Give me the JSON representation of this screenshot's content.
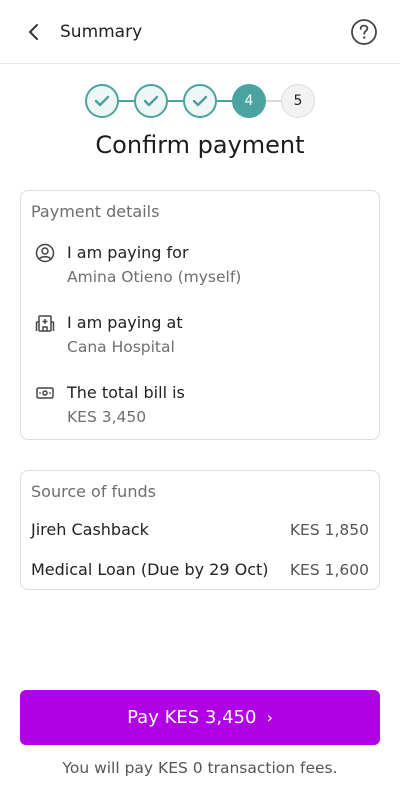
{
  "header": {
    "title": "Summary"
  },
  "stepper": {
    "steps": [
      "1",
      "2",
      "3",
      "4",
      "5"
    ],
    "current": 4
  },
  "page": {
    "title": "Confirm payment"
  },
  "payment_details": {
    "title": "Payment details",
    "items": [
      {
        "icon": "user-circle-icon",
        "label": "I am paying for",
        "value": "Amina Otieno (myself)"
      },
      {
        "icon": "hospital-icon",
        "label": "I am paying at",
        "value": "Cana Hospital"
      },
      {
        "icon": "cash-icon",
        "label": "The total bill is",
        "value": "KES 3,450"
      }
    ]
  },
  "funds": {
    "title": "Source of funds",
    "items": [
      {
        "name": "Jireh Cashback",
        "amount": "KES 1,850"
      },
      {
        "name": "Medical Loan (Due by 29 Oct)",
        "amount": "KES 1,600"
      }
    ]
  },
  "cta": {
    "label": "Pay KES 3,450",
    "chevron": "›"
  },
  "fee_note": "You will pay KES 0 transaction fees.",
  "colors": {
    "accent": "#4aa3a1",
    "button": "#b000e6"
  }
}
